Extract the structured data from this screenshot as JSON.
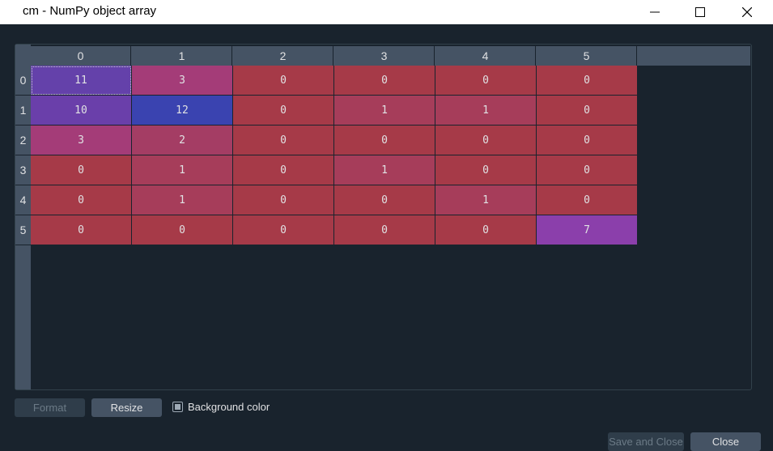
{
  "window": {
    "title": "cm - NumPy object array"
  },
  "table": {
    "columns": [
      "0",
      "1",
      "2",
      "3",
      "4",
      "5"
    ],
    "rows": [
      "0",
      "1",
      "2",
      "3",
      "4",
      "5"
    ],
    "values": [
      [
        "11",
        "3",
        "0",
        "0",
        "0",
        "0"
      ],
      [
        "10",
        "12",
        "0",
        "1",
        "1",
        "0"
      ],
      [
        "3",
        "2",
        "0",
        "0",
        "0",
        "0"
      ],
      [
        "0",
        "1",
        "0",
        "1",
        "0",
        "0"
      ],
      [
        "0",
        "1",
        "0",
        "0",
        "1",
        "0"
      ],
      [
        "0",
        "0",
        "0",
        "0",
        "0",
        "7"
      ]
    ],
    "cell_colors": [
      [
        "#6441aa",
        "#a43c78",
        "#a63a48",
        "#a63a48",
        "#a63a48",
        "#a63a48"
      ],
      [
        "#6a3faa",
        "#3a43b0",
        "#a63a48",
        "#a63d5a",
        "#a63d5a",
        "#a63a48"
      ],
      [
        "#a43c78",
        "#a43d64",
        "#a63a48",
        "#a63a48",
        "#a63a48",
        "#a63a48"
      ],
      [
        "#a63a48",
        "#a63d5a",
        "#a63a48",
        "#a63d5a",
        "#a63a48",
        "#a63a48"
      ],
      [
        "#a63a48",
        "#a63d5a",
        "#a63a48",
        "#a63a48",
        "#a63d5a",
        "#a63a48"
      ],
      [
        "#a63a48",
        "#a63a48",
        "#a63a48",
        "#a63a48",
        "#a63a48",
        "#8b3fab"
      ]
    ]
  },
  "buttons": {
    "format": "Format",
    "resize": "Resize",
    "save_and_close": "Save and Close",
    "close": "Close"
  },
  "options": {
    "background_color_label": "Background color",
    "background_color_checked": true
  },
  "icons": {
    "minimize": "minimize-icon",
    "maximize": "maximize-icon",
    "close": "close-icon"
  }
}
